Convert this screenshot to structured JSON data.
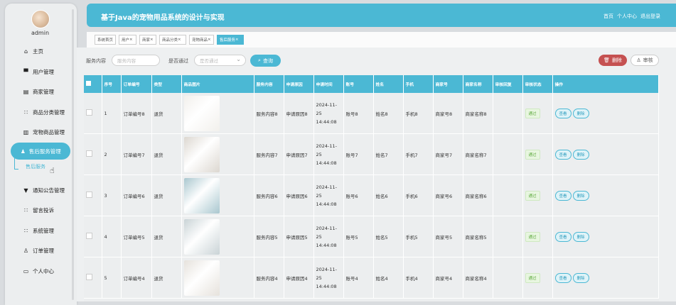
{
  "sidebar": {
    "username": "admin",
    "items": [
      {
        "icon": "home-icon",
        "glyph": "⌂",
        "label": "主页"
      },
      {
        "icon": "monitor-icon",
        "glyph": "▀",
        "label": "用户管理"
      },
      {
        "icon": "document-icon",
        "glyph": "▤",
        "label": "商家管理"
      },
      {
        "icon": "grid-icon",
        "glyph": "∷",
        "label": "商品分类管理"
      },
      {
        "icon": "bar-chart-icon",
        "glyph": "▥",
        "label": "宠物商品管理"
      },
      {
        "icon": "user-icon",
        "glyph": "♟",
        "label": "售后服务管理"
      },
      {
        "icon": "flag-icon",
        "glyph": "▼",
        "label": "通知公告管理"
      },
      {
        "icon": "grid-icon",
        "glyph": "∷",
        "label": "留言投诉"
      },
      {
        "icon": "grid-icon",
        "glyph": "∷",
        "label": "系统管理"
      },
      {
        "icon": "person-icon",
        "glyph": "♙",
        "label": "订单管理"
      },
      {
        "icon": "id-card-icon",
        "glyph": "▭",
        "label": "个人中心"
      }
    ],
    "sub_item": "售后服务"
  },
  "header": {
    "title": "基于Java的宠物用品系统的设计与实现",
    "links": [
      "首页",
      "个人中心",
      "退出登录"
    ]
  },
  "tabs": [
    {
      "label": "系统首页",
      "closable": false,
      "active": false
    },
    {
      "label": "用户",
      "closable": true,
      "active": false
    },
    {
      "label": "商家",
      "closable": true,
      "active": false
    },
    {
      "label": "商品分类",
      "closable": true,
      "active": false
    },
    {
      "label": "宠物商品",
      "closable": true,
      "active": false
    },
    {
      "label": "售后服务",
      "closable": true,
      "active": true
    }
  ],
  "filters": {
    "service_label": "服务内容",
    "service_placeholder": "服务内容",
    "audit_label": "是否通过",
    "audit_placeholder": "是否通过",
    "search_button": "查询"
  },
  "actions": {
    "delete": "删除",
    "audit": "审核"
  },
  "table": {
    "headers": [
      "序号",
      "订单编号",
      "类型",
      "商品图片",
      "服务内容",
      "申请原因",
      "申请时间",
      "账号",
      "姓名",
      "手机",
      "商家号",
      "商家名称",
      "审核回复",
      "审核状态",
      "操作"
    ],
    "rows": [
      {
        "no": "1",
        "order": "订单编号8",
        "type": "退货",
        "content": "服务内容8",
        "reason": "申请原因8",
        "time": "2024-11-25 14:44:08",
        "account": "账号8",
        "name": "姓名8",
        "phone": "手机8",
        "merchant_no": "商家号8",
        "merchant_name": "商家名称8",
        "reply": "",
        "status": "通过",
        "img": "#f2f0ec"
      },
      {
        "no": "2",
        "order": "订单编号7",
        "type": "退货",
        "content": "服务内容7",
        "reason": "申请原因7",
        "time": "2024-11-25 14:44:08",
        "account": "账号7",
        "name": "姓名7",
        "phone": "手机7",
        "merchant_no": "商家号7",
        "merchant_name": "商家名称7",
        "reply": "",
        "status": "通过",
        "img": "#dcd7d0"
      },
      {
        "no": "3",
        "order": "订单编号6",
        "type": "退货",
        "content": "服务内容6",
        "reason": "申请原因6",
        "time": "2024-11-25 14:44:08",
        "account": "账号6",
        "name": "姓名6",
        "phone": "手机6",
        "merchant_no": "商家号6",
        "merchant_name": "商家名称6",
        "reply": "",
        "status": "通过",
        "img": "#a9c7cf"
      },
      {
        "no": "4",
        "order": "订单编号5",
        "type": "退货",
        "content": "服务内容5",
        "reason": "申请原因5",
        "time": "2024-11-25 14:44:08",
        "account": "账号5",
        "name": "姓名5",
        "phone": "手机5",
        "merchant_no": "商家号5",
        "merchant_name": "商家名称5",
        "reply": "",
        "status": "通过",
        "img": "#c9d3d6"
      },
      {
        "no": "5",
        "order": "订单编号4",
        "type": "退货",
        "content": "服务内容4",
        "reason": "申请原因4",
        "time": "2024-11-25 14:44:08",
        "account": "账号4",
        "name": "姓名4",
        "phone": "手机4",
        "merchant_no": "商家号4",
        "merchant_name": "商家名称4",
        "reply": "",
        "status": "通过",
        "img": "#e6e2dc"
      }
    ],
    "row_actions": [
      "查看",
      "删除"
    ]
  },
  "colors": {
    "accent": "#4bb8d4",
    "danger": "#c55151",
    "success": "#5aa83a"
  }
}
